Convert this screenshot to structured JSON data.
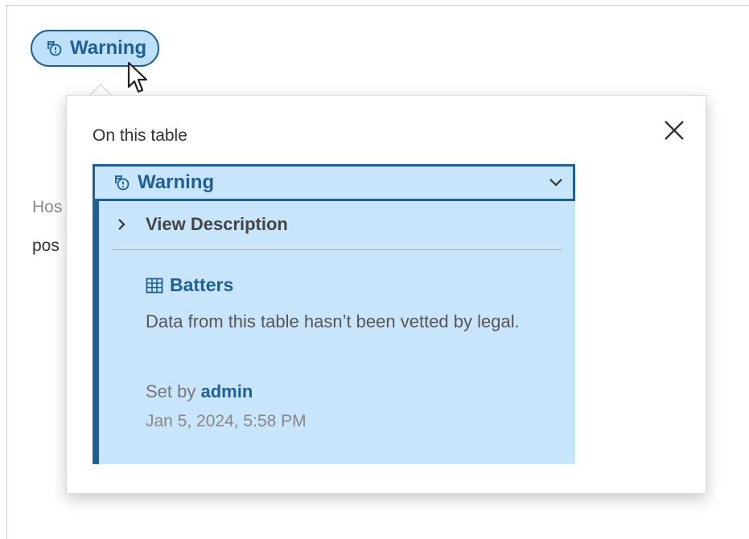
{
  "chip": {
    "label": "Warning",
    "icon": "warning-certification-icon"
  },
  "background": {
    "partial_line_1": "Hos",
    "partial_line_2": "pos"
  },
  "popover": {
    "title": "On this table",
    "close_icon": "close-icon",
    "warning": {
      "header_label": "Warning",
      "header_icon": "warning-certification-icon",
      "toggle_icon": "chevron-down-icon",
      "view_description_label": "View Description",
      "view_description_icon": "chevron-right-icon",
      "table_icon": "table-grid-icon",
      "table_name": "Batters",
      "description": "Data from this table hasn’t been vetted by legal.",
      "set_by_prefix": "Set by",
      "set_by_user": "admin",
      "timestamp": "Jan 5, 2024, 5:58 PM"
    }
  },
  "colors": {
    "accent": "#1f5f95",
    "chip_background": "#bfe0fa",
    "card_background": "#c9e5fb"
  }
}
